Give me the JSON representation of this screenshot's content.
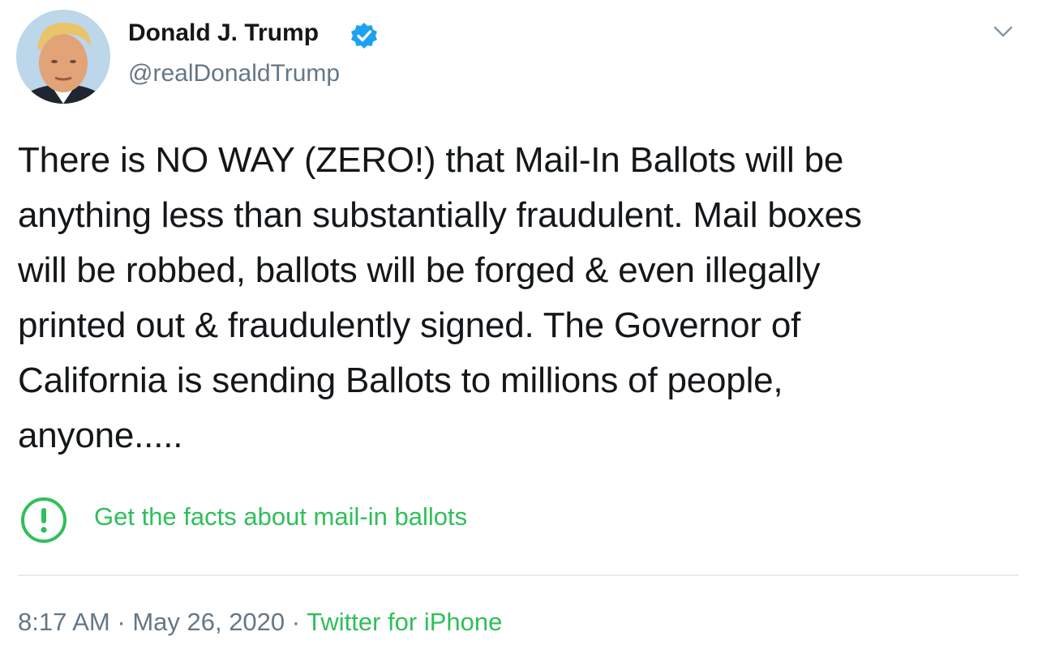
{
  "user": {
    "display_name": "Donald J. Trump",
    "handle": "@realDonaldTrump",
    "verified": true,
    "verified_icon": "verified-badge-icon"
  },
  "tweet": {
    "text": "There is NO WAY (ZERO!) that Mail-In Ballots will be\nanything less than substantially fraudulent. Mail boxes\nwill be robbed, ballots will be forged & even illegally\nprinted out & fraudulently signed. The Governor of\nCalifornia is sending Ballots to millions of people,\nanyone....."
  },
  "fact_check": {
    "icon": "exclamation-circle-icon",
    "label": "Get the facts about mail-in ballots",
    "color": "#2fbf5a"
  },
  "meta": {
    "time": "8:17 AM",
    "separator": " · ",
    "date": "May 26, 2020",
    "source": "Twitter for iPhone"
  },
  "colors": {
    "text": "#14171a",
    "secondary": "#657786",
    "verified_blue": "#1da1f2",
    "link_green": "#2fbf5a",
    "divider": "#e6ecf0"
  }
}
